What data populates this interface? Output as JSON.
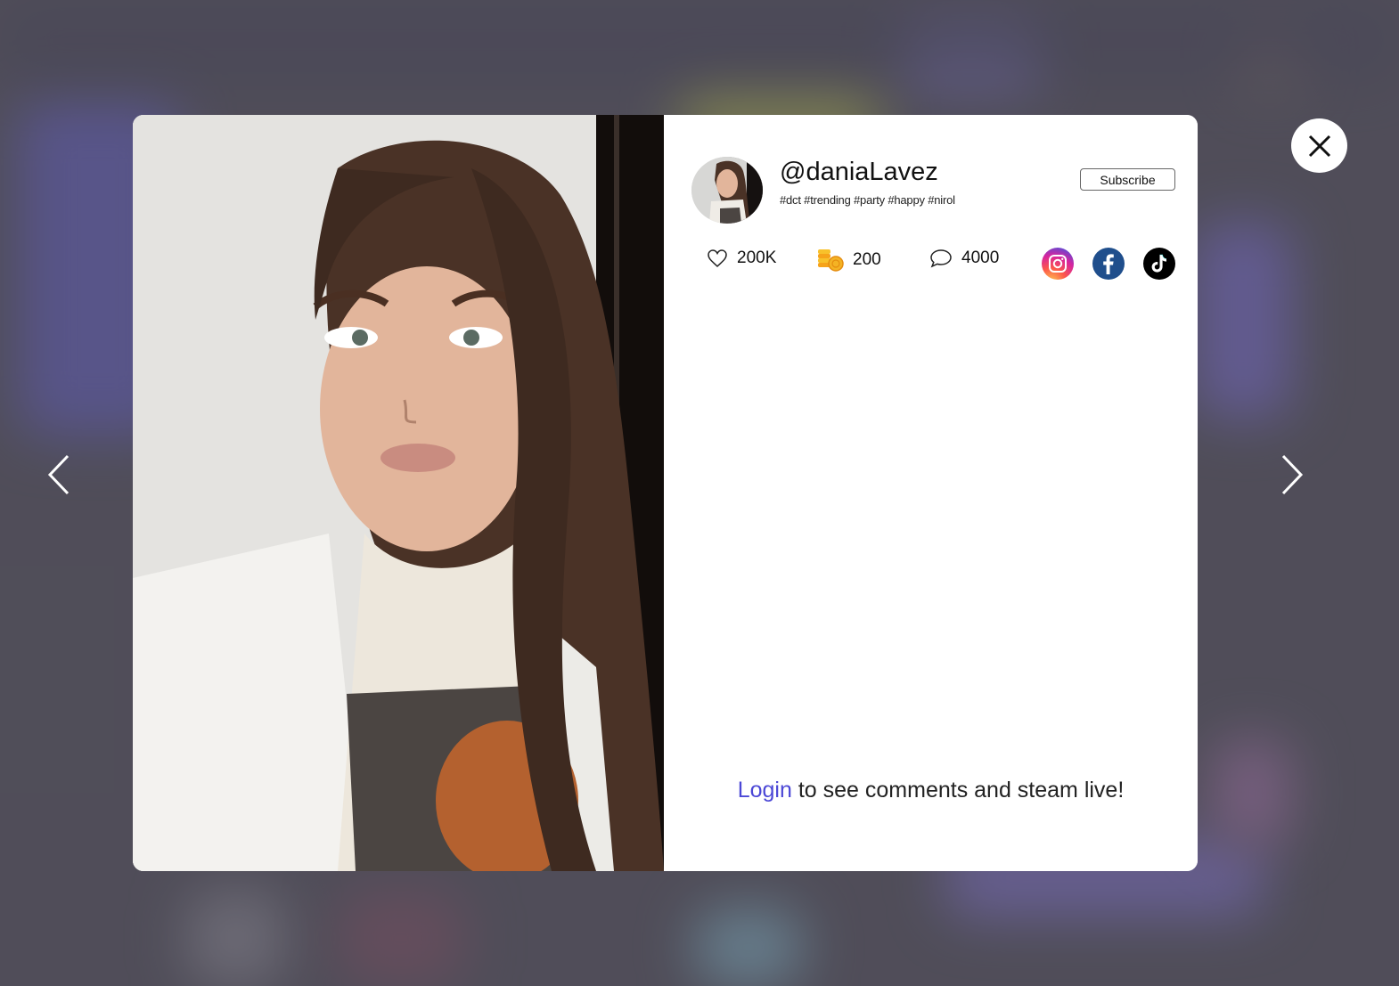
{
  "post": {
    "username": "@daniaLavez",
    "tags": "#dct #trending #party #happy #nirol",
    "subscribe_label": "Subscribe"
  },
  "stats": {
    "likes": "200K",
    "coins": "200",
    "comments": "4000"
  },
  "social": [
    "instagram-icon",
    "facebook-icon",
    "tiktok-icon"
  ],
  "footer": {
    "login_link": "Login",
    "login_text": " to see comments and steam live!"
  },
  "colors": {
    "link": "#4b47d6",
    "instagram": "#e0245e",
    "facebook": "#1f4e8c",
    "tiktok": "#000000"
  }
}
